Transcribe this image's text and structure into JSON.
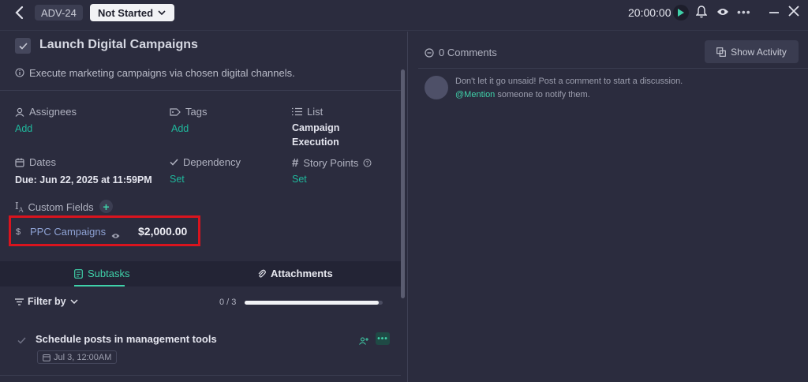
{
  "header": {
    "task_id": "ADV-24",
    "status": "Not Started",
    "timer": "20:00:00"
  },
  "task": {
    "title": "Launch Digital Campaigns",
    "description": "Execute marketing campaigns via chosen digital channels."
  },
  "fields": {
    "assignees": {
      "label": "Assignees",
      "value": "Add"
    },
    "tags": {
      "label": "Tags",
      "value": "Add"
    },
    "list": {
      "label": "List",
      "value_line1": "Campaign",
      "value_line2": "Execution"
    },
    "dates": {
      "label": "Dates",
      "value": "Due: Jun 22, 2025 at 11:59PM"
    },
    "dependency": {
      "label": "Dependency",
      "value": "Set"
    },
    "story_points": {
      "label": "Story Points",
      "value": "Set"
    }
  },
  "custom_fields": {
    "label": "Custom Fields",
    "items": [
      {
        "symbol": "$",
        "name": "PPC Campaigns",
        "value": "$2,000.00"
      }
    ]
  },
  "tabs": {
    "subtasks": "Subtasks",
    "attachments": "Attachments"
  },
  "subtasks": {
    "filter_label": "Filter by",
    "progress_text": "0 / 3",
    "progress_fraction": 0.97,
    "items": [
      {
        "name": "Schedule posts in management tools",
        "date": "Jul 3, 12:00AM"
      }
    ]
  },
  "comments": {
    "title": "0 Comments",
    "show_activity": "Show Activity",
    "prompt_line1": "Don't let it go unsaid! Post a comment to start a discussion.",
    "mention": "@Mention",
    "prompt_line2_rest": " someone to notify them."
  },
  "colors": {
    "background": "#2b2c3e",
    "accent": "#3fd1a9",
    "highlight_box": "#d9141e"
  }
}
